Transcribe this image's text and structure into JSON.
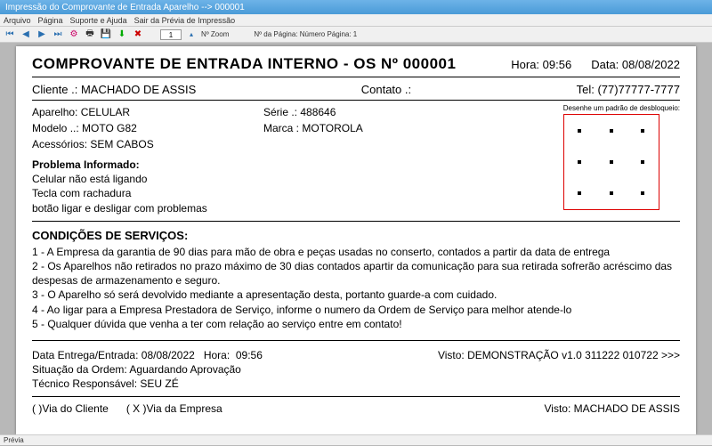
{
  "window": {
    "title": "Impressão do Comprovante de Entrada Aparelho --> 000001"
  },
  "menu": {
    "arquivo": "Arquivo",
    "pagina": "Página",
    "suporte": "Suporte e Ajuda",
    "sair": "Sair da Prévia de Impressão"
  },
  "toolbar": {
    "zoom_value": "1",
    "zoom_lbl": "Nº Zoom",
    "page_lbl": "Nº da Página: Número Página: 1"
  },
  "statusbar": {
    "text": "Prévia"
  },
  "doc": {
    "title": "COMPROVANTE DE ENTRADA INTERNO - OS Nº 000001",
    "hora_lbl": "Hora:",
    "hora": "09:56",
    "data_lbl": "Data:",
    "data": "08/08/2022",
    "cliente_lbl": "Cliente   .:",
    "cliente": "MACHADO DE ASSIS",
    "contato_lbl": "Contato .:",
    "tel_lbl": "Tel:",
    "tel": "(77)77777-7777",
    "aparelho_lbl": "Aparelho:",
    "aparelho": "CELULAR",
    "serie_lbl": "Série  .:",
    "serie": "488646",
    "modelo_lbl": "Modelo ..:",
    "modelo": "MOTO G82",
    "marca_lbl": "Marca :",
    "marca": "MOTOROLA",
    "acess_lbl": "Acessórios:",
    "acess": "SEM CABOS",
    "pattern_cap": "Desenhe um padrão de desbloqueio:",
    "problem_title": "Problema Informado:",
    "problem_l1": "Celular não está ligando",
    "problem_l2": "Tecla com rachadura",
    "problem_l3": "botão ligar e desligar com problemas",
    "cond_title": "CONDIÇÕES DE SERVIÇOS:",
    "cond_1": "1 - A Empresa da garantia de 90 dias para mão de obra e peças usadas no conserto, contados  a partir da data de entrega",
    "cond_2": "2 - Os Aparelhos não retirados no prazo máximo de 30 dias contados apartir da comunicação para sua retirada sofrerão acréscimo das despesas de armazenamento e seguro.",
    "cond_3": "3 - O Aparelho só será devolvido mediante a apresentação desta, portanto guarde-a com cuidado.",
    "cond_4": "4 - Ao ligar para a Empresa Prestadora de Serviço, informe o numero da Ordem de Serviço para melhor atende-lo",
    "cond_5": "5 - Qualquer dúvida que venha a ter com relação ao serviço entre em contato!",
    "entrega_lbl": "Data Entrega/Entrada:",
    "entrega": "08/08/2022",
    "entrega_hora_lbl": "Hora:",
    "entrega_hora": "09:56",
    "visto1_lbl": "Visto:",
    "visto1": "DEMONSTRAÇÃO v1.0 311222 010722 >>>",
    "situacao_lbl": "Situação da Ordem:",
    "situacao": "Aguardando Aprovação",
    "tecnico_lbl": "Técnico Responsável:",
    "tecnico": "SEU ZÉ",
    "via_cliente": "(   )Via do Cliente",
    "via_empresa": "( X )Via da Empresa",
    "visto2_lbl": "Visto:",
    "visto2": "MACHADO DE ASSIS"
  }
}
